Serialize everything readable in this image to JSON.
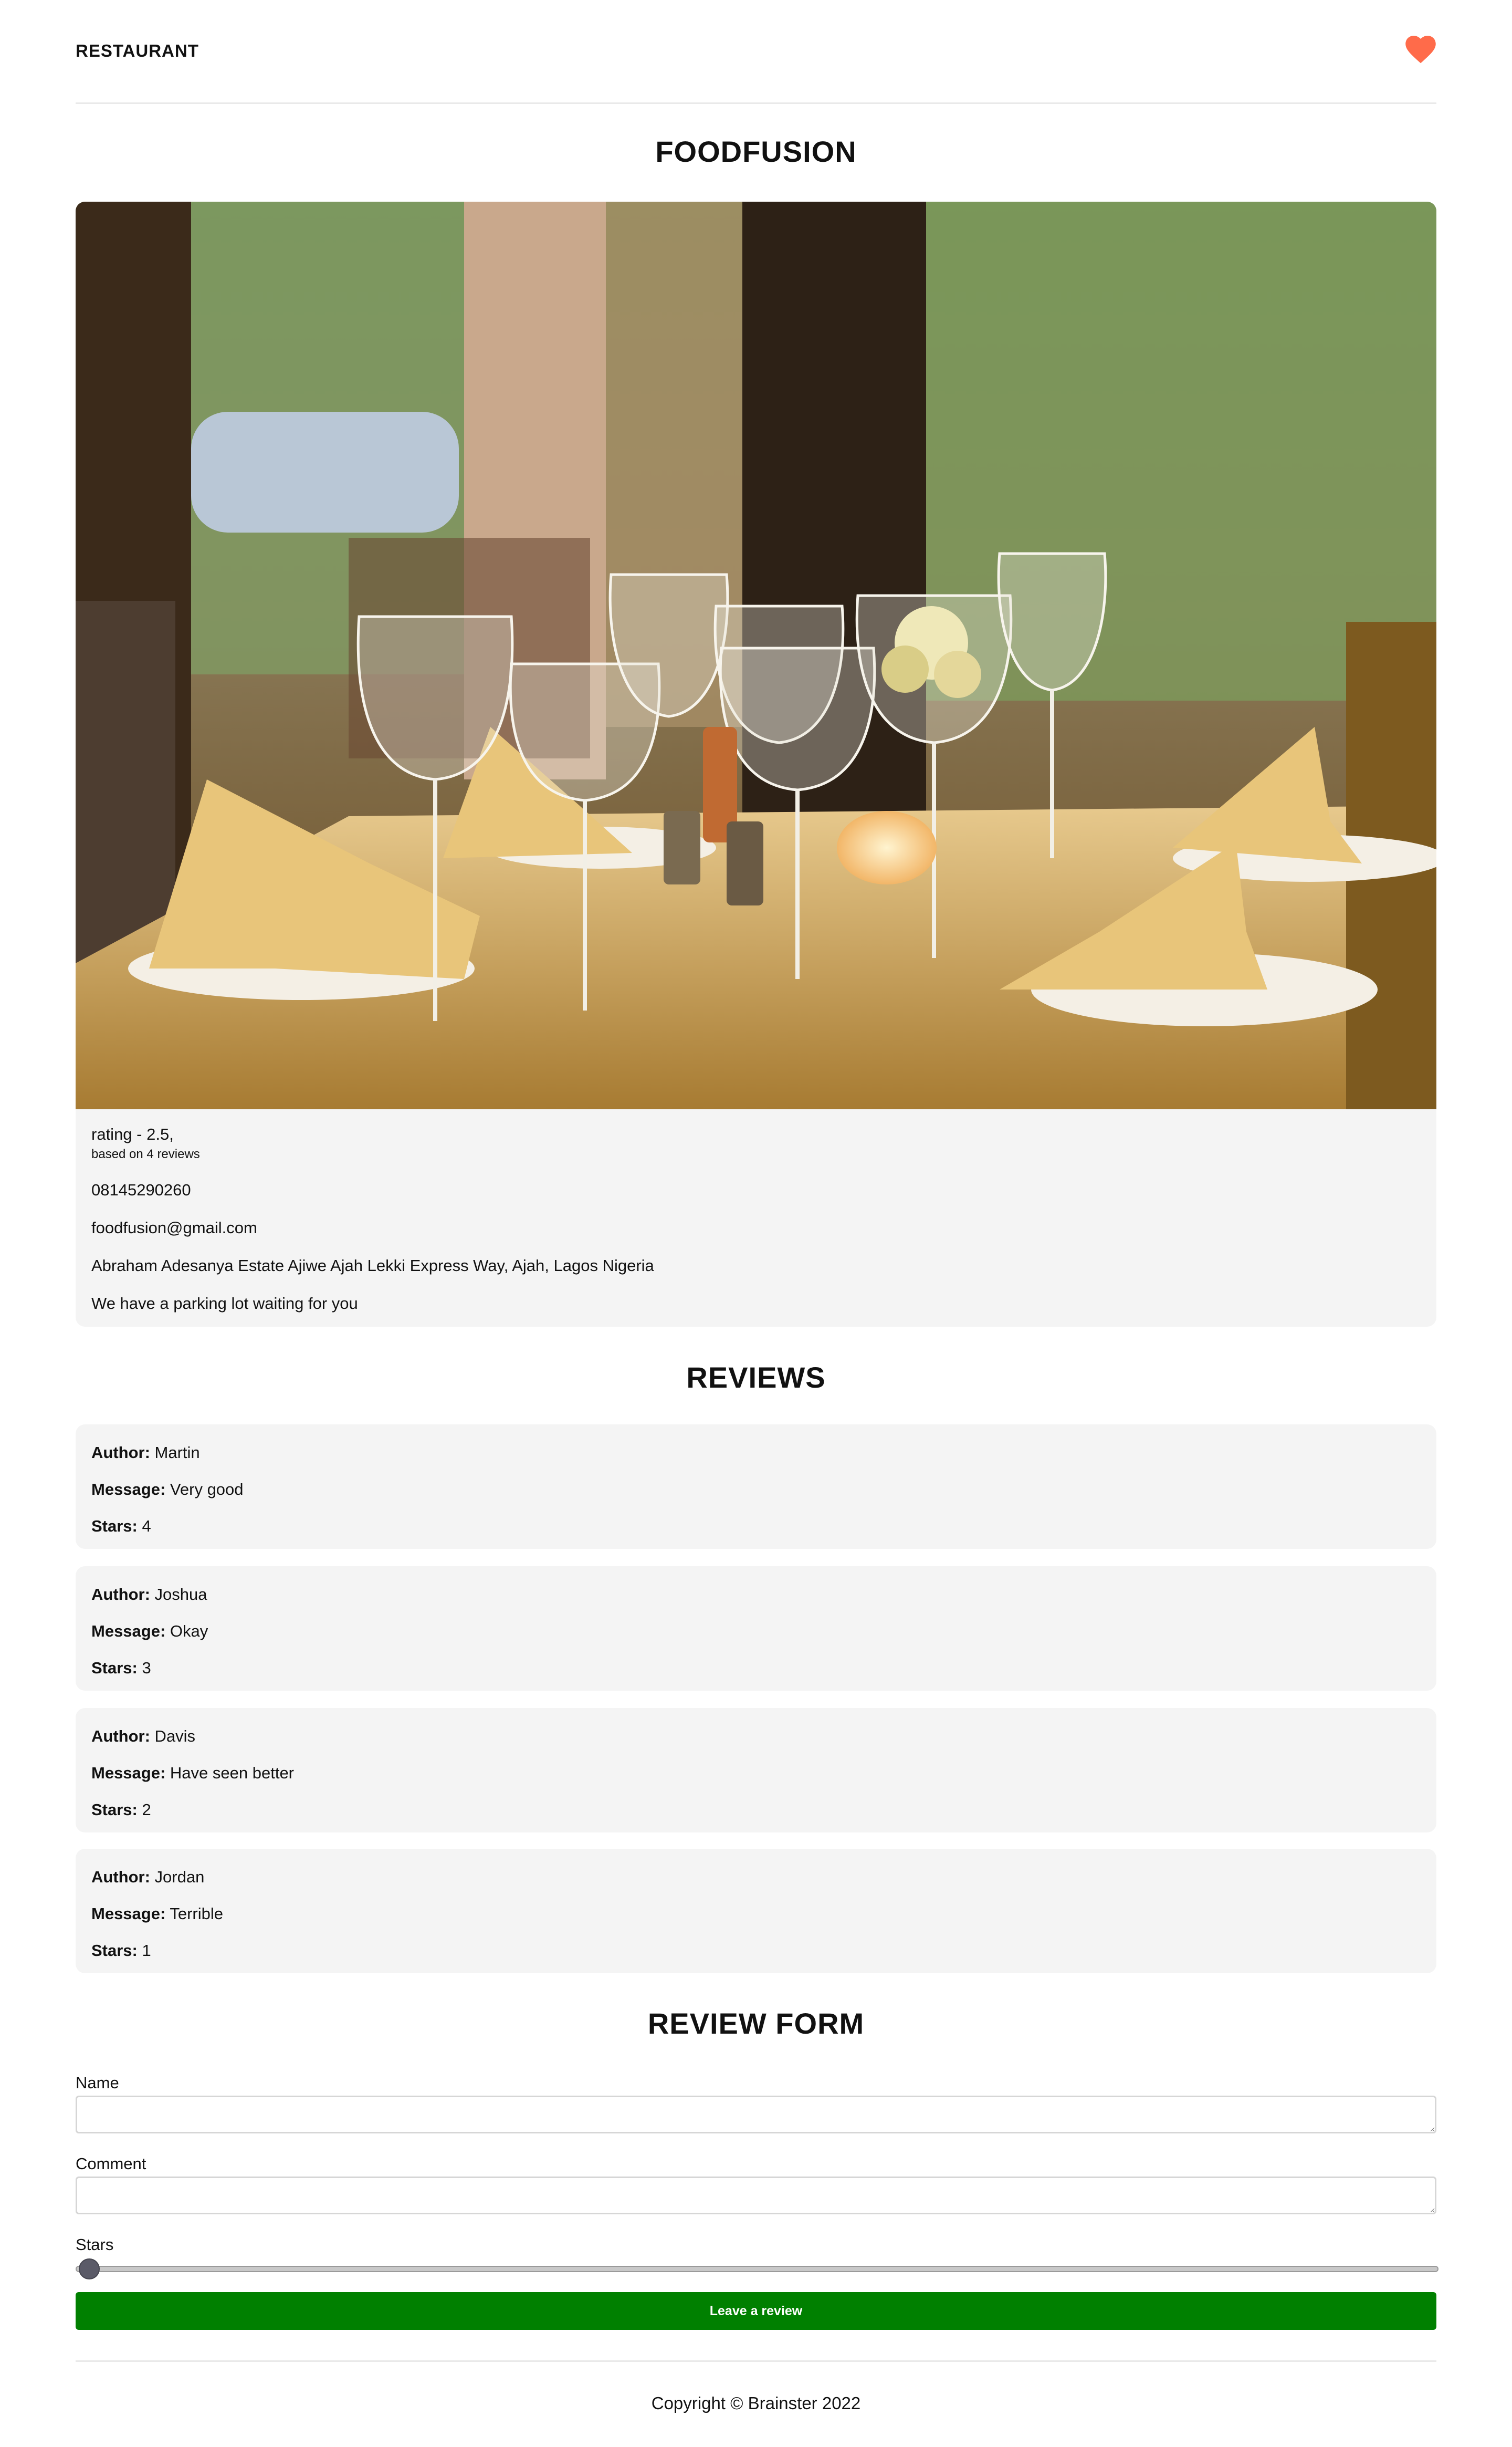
{
  "header": {
    "brand": "RESTAURANT",
    "favorite_icon": "heart-icon",
    "favorite_color": "#ff6b4a"
  },
  "restaurant": {
    "name": "FOODFUSION",
    "photo": "restaurant-table-photo",
    "rating": "rating - 2.5,",
    "based_on": "based on 4 reviews",
    "phone": "08145290260",
    "email": "foodfusion@gmail.com",
    "address": "Abraham Adesanya Estate Ajiwe Ajah Lekki Express Way, Ajah, Lagos Nigeria",
    "parking": "We have a parking lot waiting for you"
  },
  "reviews": {
    "title": "REVIEWS",
    "author_label": "Author:",
    "message_label": "Message:",
    "stars_label": "Stars:",
    "items": [
      {
        "author": "Martin",
        "message": "Very good",
        "stars": "4"
      },
      {
        "author": "Joshua",
        "message": "Okay",
        "stars": "3"
      },
      {
        "author": "Davis",
        "message": "Have seen better",
        "stars": "2"
      },
      {
        "author": "Jordan",
        "message": "Terrible",
        "stars": "1"
      }
    ]
  },
  "form": {
    "title": "REVIEW FORM",
    "name_label": "Name",
    "name_value": "",
    "comment_label": "Comment",
    "comment_value": "",
    "stars_label": "Stars",
    "stars_value": 0,
    "submit_label": "Leave a review",
    "submit_color": "#008000"
  },
  "footer": {
    "copyright": "Copyright © Brainster 2022"
  }
}
